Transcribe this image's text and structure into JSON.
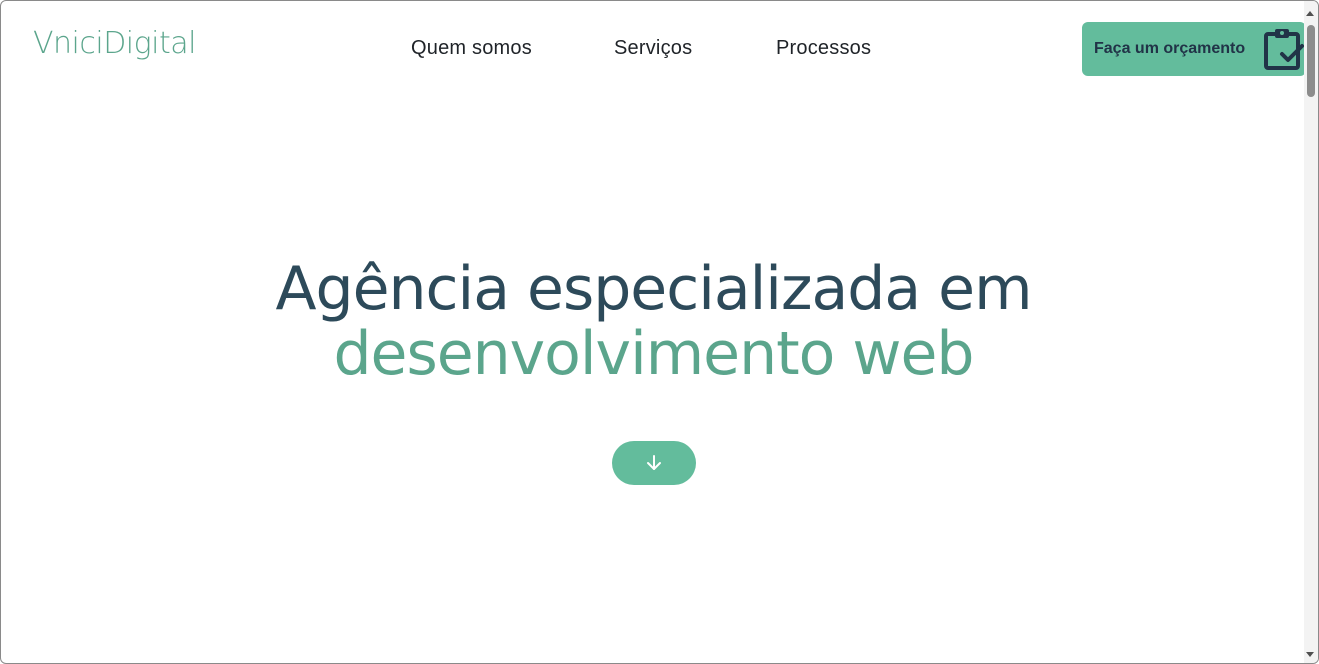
{
  "header": {
    "logo_text": "VniciDigital",
    "nav": [
      {
        "label": "Quem somos"
      },
      {
        "label": "Serviços"
      },
      {
        "label": "Processos"
      }
    ],
    "cta": {
      "label": "Faça um orçamento",
      "icon": "clipboard-check-icon"
    }
  },
  "hero": {
    "title_line1": "Agência especializada em",
    "title_line2": "desenvolvimento web",
    "scroll_button_icon": "arrow-down-icon"
  },
  "colors": {
    "accent": "#63bc9c",
    "title_dark": "#2d4a5a",
    "title_green": "#5ba58c",
    "cta_text": "#213347"
  }
}
